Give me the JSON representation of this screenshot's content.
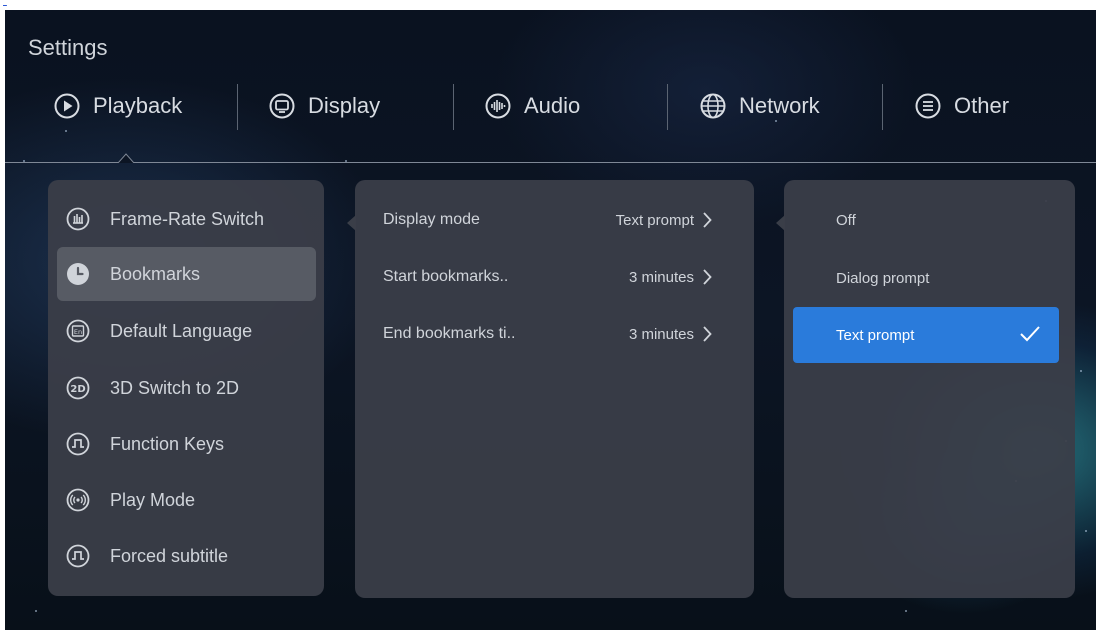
{
  "page_title": "Settings",
  "tabs": [
    {
      "label": "Playback",
      "icon": "play-circle-icon"
    },
    {
      "label": "Display",
      "icon": "monitor-icon"
    },
    {
      "label": "Audio",
      "icon": "audio-wave-icon"
    },
    {
      "label": "Network",
      "icon": "globe-icon"
    },
    {
      "label": "Other",
      "icon": "menu-circle-icon"
    }
  ],
  "active_tab": "Playback",
  "left_menu": [
    {
      "label": "Frame-Rate Switch",
      "icon": "frame-rate-icon"
    },
    {
      "label": "Bookmarks",
      "icon": "clock-icon"
    },
    {
      "label": "Default Language",
      "icon": "language-icon"
    },
    {
      "label": "3D Switch to 2D",
      "icon": "2d-icon"
    },
    {
      "label": "Function Keys",
      "icon": "function-key-icon"
    },
    {
      "label": "Play Mode",
      "icon": "play-mode-icon"
    },
    {
      "label": "Forced subtitle",
      "icon": "subtitle-icon"
    }
  ],
  "active_menu": "Bookmarks",
  "options": [
    {
      "label": "Display mode",
      "value": "Text prompt"
    },
    {
      "label": "Start bookmarks..",
      "value": "3 minutes"
    },
    {
      "label": "End bookmarks ti..",
      "value": "3 minutes"
    }
  ],
  "choices": [
    {
      "label": "Off"
    },
    {
      "label": "Dialog prompt"
    },
    {
      "label": "Text prompt"
    }
  ],
  "selected_choice": "Text prompt",
  "colors": {
    "accent": "#2a7bdb",
    "panel": "#3a3e48",
    "highlight": "#575b64"
  }
}
